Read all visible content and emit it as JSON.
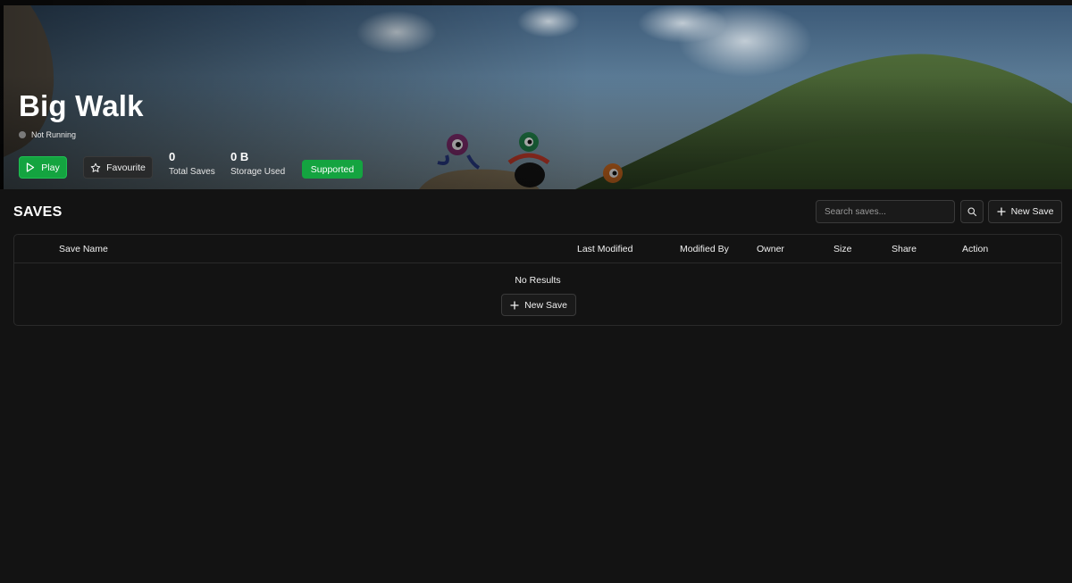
{
  "game": {
    "title": "Big Walk",
    "status": "Not Running",
    "status_color": "#7a7a7a"
  },
  "actions": {
    "play_label": "Play",
    "favourite_label": "Favourite"
  },
  "stats": {
    "total_saves_value": "0",
    "total_saves_label": "Total Saves",
    "storage_value": "0 B",
    "storage_label": "Storage Used"
  },
  "badge": {
    "label": "Supported",
    "color": "#14a440"
  },
  "saves": {
    "title": "SAVES",
    "search_placeholder": "Search saves...",
    "new_save_label": "New Save"
  },
  "table": {
    "columns": {
      "save_name": "Save Name",
      "last_modified": "Last Modified",
      "modified_by": "Modified By",
      "owner": "Owner",
      "size": "Size",
      "share": "Share",
      "action": "Action"
    },
    "empty_text": "No Results",
    "empty_button_label": "New Save"
  },
  "icons": {
    "play": "play-icon",
    "favourite": "star-icon",
    "search": "search-icon",
    "add": "plus-icon"
  },
  "colors": {
    "accent": "#14a440",
    "background": "#131313",
    "border": "#2a2a2a"
  }
}
